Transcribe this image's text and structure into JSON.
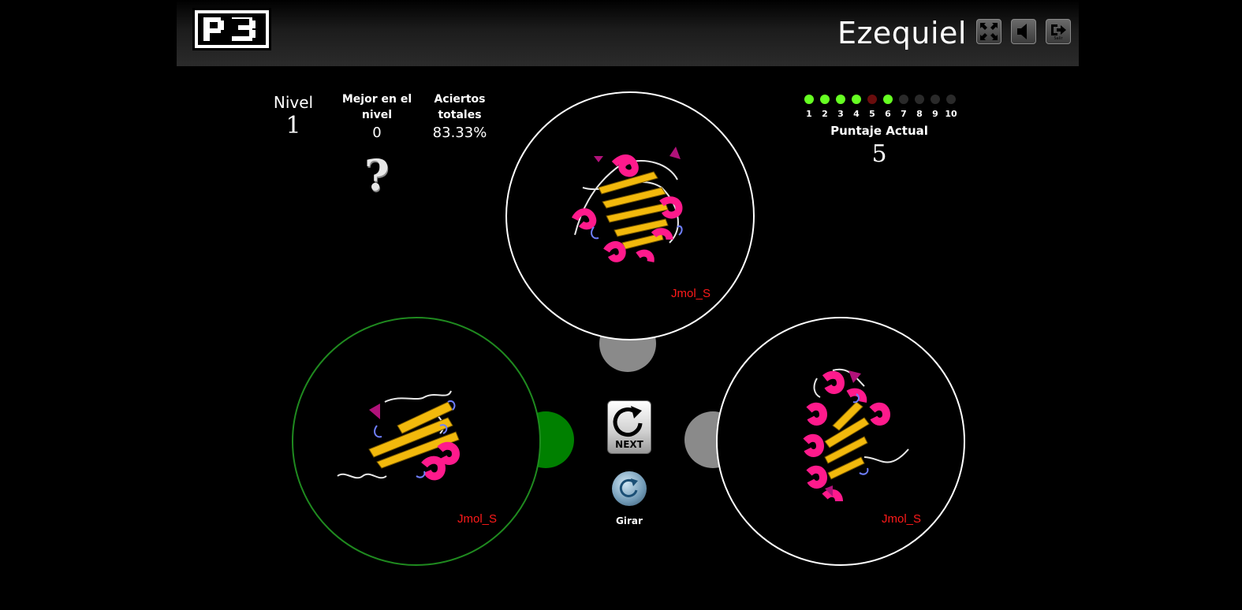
{
  "header": {
    "logo_text": "P3",
    "user_name": "Ezequiel",
    "buttons": [
      {
        "icon": "fullscreen-icon"
      },
      {
        "icon": "sound-icon"
      },
      {
        "icon": "exit-icon",
        "label": "Salir"
      }
    ]
  },
  "stats": {
    "level_label": "Nivel",
    "level_value": "1",
    "best_label": "Mejor en el nivel",
    "best_value": "0",
    "best_help": "?",
    "hits_label": "Aciertos totales",
    "hits_value": "83.33%"
  },
  "score": {
    "dots": [
      {
        "num": "1",
        "state": "correct"
      },
      {
        "num": "2",
        "state": "correct"
      },
      {
        "num": "3",
        "state": "correct"
      },
      {
        "num": "4",
        "state": "correct"
      },
      {
        "num": "5",
        "state": "wrong"
      },
      {
        "num": "6",
        "state": "correct"
      },
      {
        "num": "7",
        "state": "pending"
      },
      {
        "num": "8",
        "state": "pending"
      },
      {
        "num": "9",
        "state": "pending"
      },
      {
        "num": "10",
        "state": "pending"
      }
    ],
    "label": "Puntaje Actual",
    "value": "5"
  },
  "viewers": {
    "top": {
      "label": "Jmol_S"
    },
    "left": {
      "label": "Jmol_S",
      "selected": true
    },
    "right": {
      "label": "Jmol_S"
    }
  },
  "controls": {
    "next_label": "NEXT",
    "spin_label": "Girar"
  },
  "colors": {
    "correct": "#66ff22",
    "wrong": "#6a0d0d",
    "pending": "#2a2a2a",
    "selected_ring": "#1f8a1f",
    "selected_knob": "#008000",
    "knob": "#8a8a8a",
    "helix": "#ff1a8c",
    "sheet": "#f2b90c",
    "coil": "#e0e0e0",
    "turn": "#6f7fff"
  }
}
